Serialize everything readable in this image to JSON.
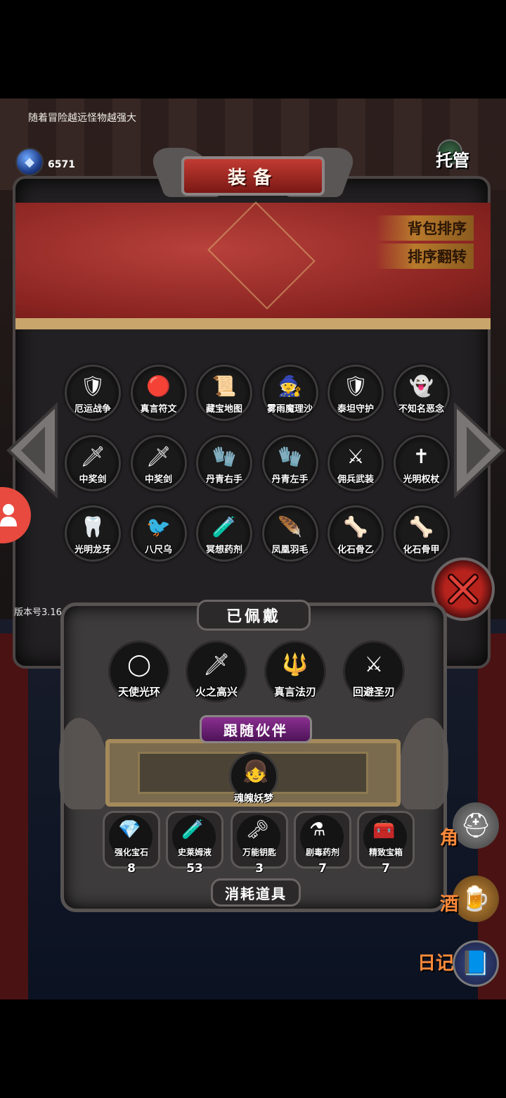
{
  "tip": "随着冒险越远怪物越强大",
  "currency": {
    "amount": "6571",
    "icon": "gem-icon",
    "icon_caption": "宝石"
  },
  "auto_label": "托管",
  "panel": {
    "title": "装备",
    "sort_pack": "背包排序",
    "sort_flip": "排序翻转"
  },
  "items": [
    {
      "name": "厄运战争",
      "icon": "red-armor",
      "glyph": "🛡"
    },
    {
      "name": "真言符文",
      "icon": "rune",
      "glyph": "🔴"
    },
    {
      "name": "藏宝地图",
      "icon": "map",
      "glyph": "📜"
    },
    {
      "name": "雾雨魔理沙",
      "icon": "witch",
      "glyph": "🧙"
    },
    {
      "name": "泰坦守护",
      "icon": "titan-shield",
      "glyph": "🛡"
    },
    {
      "name": "不知名恶念",
      "icon": "ghost",
      "glyph": "👻"
    },
    {
      "name": "中奖剑",
      "icon": "sword",
      "glyph": "🗡"
    },
    {
      "name": "中奖剑",
      "icon": "sword",
      "glyph": "🗡"
    },
    {
      "name": "丹青右手",
      "icon": "gauntlet",
      "glyph": "🧤"
    },
    {
      "name": "丹青左手",
      "icon": "gauntlet",
      "glyph": "🧤"
    },
    {
      "name": "佣兵武装",
      "icon": "armor",
      "glyph": "⚔"
    },
    {
      "name": "光明权杖",
      "icon": "scepter",
      "glyph": "✝"
    },
    {
      "name": "光明龙牙",
      "icon": "fang",
      "glyph": "🦷"
    },
    {
      "name": "八尺乌",
      "icon": "crow",
      "glyph": "🐦"
    },
    {
      "name": "冥想药剂",
      "icon": "potion",
      "glyph": "🧪"
    },
    {
      "name": "凤凰羽毛",
      "icon": "feather",
      "glyph": "🪶"
    },
    {
      "name": "化石骨乙",
      "icon": "bone",
      "glyph": "🦴"
    },
    {
      "name": "化石骨甲",
      "icon": "bone",
      "glyph": "🦴"
    }
  ],
  "version": "版本号3.16",
  "worn": {
    "title": "已佩戴",
    "slots": [
      {
        "name": "天使光环",
        "icon": "halo",
        "glyph": "◯"
      },
      {
        "name": "火之高兴",
        "icon": "fire-blade",
        "glyph": "🗡"
      },
      {
        "name": "真言法刃",
        "icon": "staff",
        "glyph": "🔱"
      },
      {
        "name": "回避圣刃",
        "icon": "holy-blade",
        "glyph": "⚔"
      }
    ]
  },
  "companion": {
    "title": "跟随伙伴",
    "name": "魂魄妖梦",
    "glyph": "👧"
  },
  "consumables": {
    "title": "消耗道具",
    "items": [
      {
        "name": "强化宝石",
        "count": "8",
        "glyph": "💎"
      },
      {
        "name": "史莱姆液",
        "count": "53",
        "glyph": "🧪"
      },
      {
        "name": "万能钥匙",
        "count": "3",
        "glyph": "🗝"
      },
      {
        "name": "剧毒药剂",
        "count": "7",
        "glyph": "⚗"
      },
      {
        "name": "精致宝箱",
        "count": "7",
        "glyph": "🧰"
      }
    ]
  },
  "side": {
    "diary": "日记",
    "cut1": "角",
    "cut2": "酒"
  }
}
